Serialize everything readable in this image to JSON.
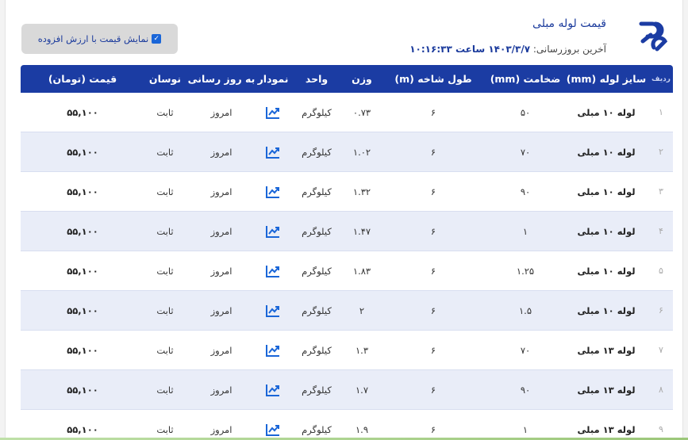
{
  "header": {
    "title": "قیمت لوله مبلی",
    "updated_prefix": "آخرین بروزرسانی:",
    "updated_value": "۱۴۰۳/۳/۷ ساعت ۱۰:۱۶:۳۳",
    "logo_icon": "brand-logo-icon",
    "brand_color": "#1b3ca3"
  },
  "vat_toggle": {
    "label": "نمایش قیمت با ارزش افزوده",
    "checked": true
  },
  "table": {
    "columns": [
      "ردیف",
      "سایز لوله (mm)",
      "ضخامت (mm)",
      "طول شاخه (m)",
      "وزن",
      "واحد",
      "نمودار",
      "به روز رسانی",
      "نوسان",
      "قیمت (تومان)"
    ],
    "rows": [
      {
        "idx": "۱",
        "size": "لوله ۱۰ مبلی",
        "thickness": "۵۰",
        "length": "۶",
        "weight": "۰.۷۳",
        "unit": "کیلوگرم",
        "updated": "امروز",
        "fluctuation": "ثابت",
        "price": "۵۵,۱۰۰"
      },
      {
        "idx": "۲",
        "size": "لوله ۱۰ مبلی",
        "thickness": "۷۰",
        "length": "۶",
        "weight": "۱.۰۲",
        "unit": "کیلوگرم",
        "updated": "امروز",
        "fluctuation": "ثابت",
        "price": "۵۵,۱۰۰"
      },
      {
        "idx": "۳",
        "size": "لوله ۱۰ مبلی",
        "thickness": "۹۰",
        "length": "۶",
        "weight": "۱.۳۲",
        "unit": "کیلوگرم",
        "updated": "امروز",
        "fluctuation": "ثابت",
        "price": "۵۵,۱۰۰"
      },
      {
        "idx": "۴",
        "size": "لوله ۱۰ مبلی",
        "thickness": "۱",
        "length": "۶",
        "weight": "۱.۴۷",
        "unit": "کیلوگرم",
        "updated": "امروز",
        "fluctuation": "ثابت",
        "price": "۵۵,۱۰۰"
      },
      {
        "idx": "۵",
        "size": "لوله ۱۰ مبلی",
        "thickness": "۱.۲۵",
        "length": "۶",
        "weight": "۱.۸۳",
        "unit": "کیلوگرم",
        "updated": "امروز",
        "fluctuation": "ثابت",
        "price": "۵۵,۱۰۰"
      },
      {
        "idx": "۶",
        "size": "لوله ۱۰ مبلی",
        "thickness": "۱.۵",
        "length": "۶",
        "weight": "۲",
        "unit": "کیلوگرم",
        "updated": "امروز",
        "fluctuation": "ثابت",
        "price": "۵۵,۱۰۰"
      },
      {
        "idx": "۷",
        "size": "لوله ۱۳ مبلی",
        "thickness": "۷۰",
        "length": "۶",
        "weight": "۱.۳",
        "unit": "کیلوگرم",
        "updated": "امروز",
        "fluctuation": "ثابت",
        "price": "۵۵,۱۰۰"
      },
      {
        "idx": "۸",
        "size": "لوله ۱۳ مبلی",
        "thickness": "۹۰",
        "length": "۶",
        "weight": "۱.۷",
        "unit": "کیلوگرم",
        "updated": "امروز",
        "fluctuation": "ثابت",
        "price": "۵۵,۱۰۰"
      },
      {
        "idx": "۹",
        "size": "لوله ۱۳ مبلی",
        "thickness": "۱",
        "length": "۶",
        "weight": "۱.۹",
        "unit": "کیلوگرم",
        "updated": "امروز",
        "fluctuation": "ثابت",
        "price": "۵۵,۱۰۰"
      }
    ],
    "chart_icon": "chart-line-icon",
    "chart_icon_color": "#1a66d8"
  }
}
